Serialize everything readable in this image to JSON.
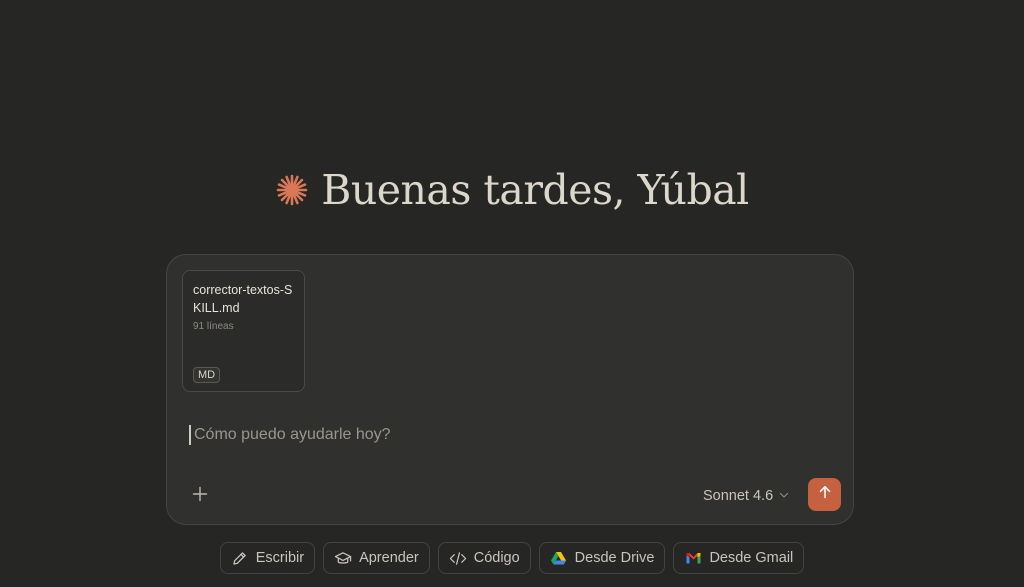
{
  "greeting": {
    "text": "Buenas tardes, Yúbal",
    "logo_icon": "asterisk-burst-icon",
    "logo_color": "#d97757"
  },
  "composer": {
    "attachment": {
      "filename": "corrector-textos-SKILL.md",
      "lines": "91 líneas",
      "type_badge": "MD"
    },
    "prompt": {
      "value": "",
      "placeholder": "Cómo puedo ayudarle hoy?"
    },
    "add_icon": "plus-icon",
    "model": "Sonnet 4.6",
    "model_icon": "chevron-down-icon",
    "send_icon": "arrow-up-icon",
    "send_color": "#c6613f"
  },
  "actions": [
    {
      "label": "Escribir",
      "icon": "pencil-icon"
    },
    {
      "label": "Aprender",
      "icon": "graduation-cap-icon"
    },
    {
      "label": "Código",
      "icon": "code-icon"
    },
    {
      "label": "Desde Drive",
      "icon": "google-drive-icon"
    },
    {
      "label": "Desde Gmail",
      "icon": "gmail-icon"
    }
  ]
}
